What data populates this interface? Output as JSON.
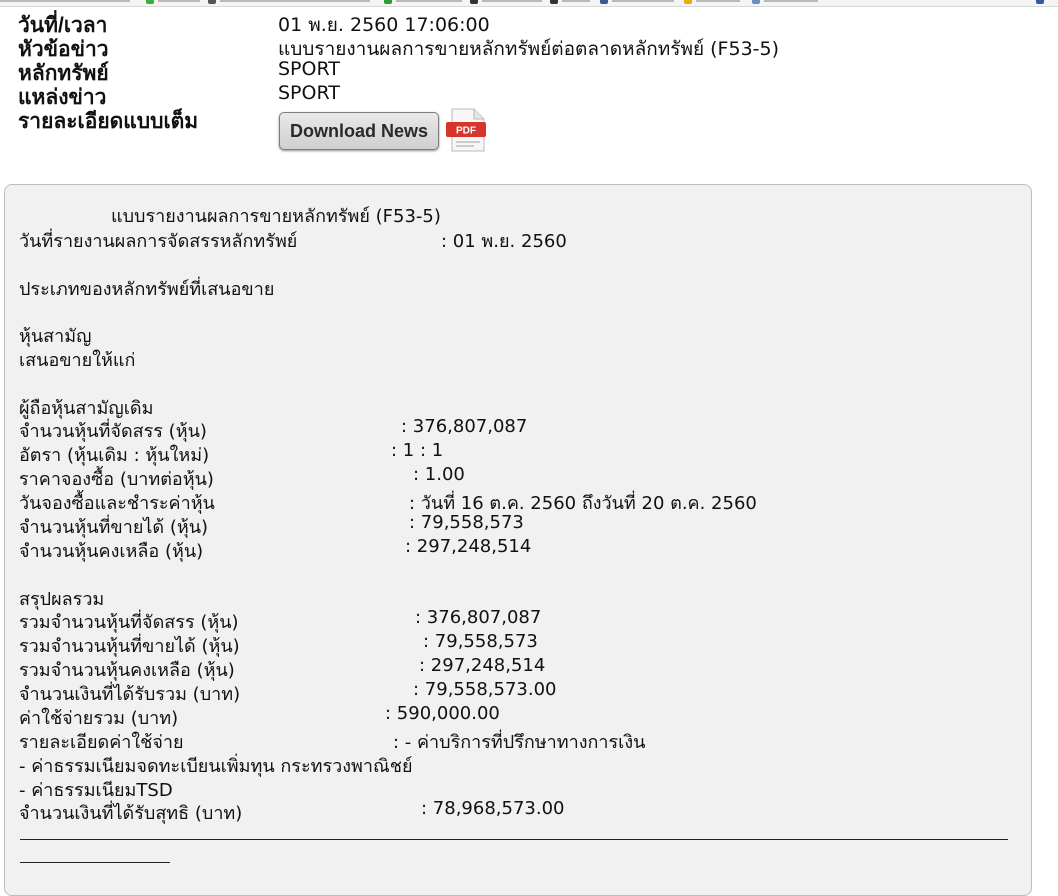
{
  "header": {
    "date_label": "วันที่/เวลา",
    "date_value": "01 พ.ย. 2560 17:06:00",
    "title_label": "หัวข้อข่าว",
    "title_value": "แบบรายงานผลการขายหลักทรัพย์ต่อตลาดหลักทรัพย์ (F53-5)",
    "symbol_label": "หลักทรัพย์",
    "symbol_value": "SPORT",
    "source_label": "แหล่งข่าว",
    "source_value": "SPORT",
    "detail_label": "รายละเอียดแบบเต็ม",
    "download_label": "Download News",
    "pdf_label": "PDF"
  },
  "news": {
    "form_title": "แบบรายงานผลการขายหลักทรัพย์ (F53-5)",
    "report_date_label": "วันที่รายงานผลการจัดสรรหลักทรัพย์",
    "report_date_value": ": 01 พ.ย. 2560",
    "security_type_label": "ประเภทของหลักทรัพย์ที่เสนอขาย",
    "security_type_value": "หุ้นสามัญ",
    "offered_to_label": "เสนอขายให้แก่",
    "offered_to_value": "ผู้ถือหุ้นสามัญเดิม",
    "allocated_label": "จำนวนหุ้นที่จัดสรร (หุ้น)",
    "allocated_value": ": 376,807,087",
    "ratio_label": "อัตรา (หุ้นเดิม : หุ้นใหม่)",
    "ratio_value": ": 1 : 1",
    "price_label": "ราคาจองซื้อ (บาทต่อหุ้น)",
    "price_value": ": 1.00",
    "period_label": "วันจองซื้อและชำระค่าหุ้น",
    "period_value": ": วันที่ 16 ต.ค. 2560 ถึงวันที่ 20 ต.ค. 2560",
    "sold_label": "จำนวนหุ้นที่ขายได้ (หุ้น)",
    "sold_value": ": 79,558,573",
    "remaining_label": "จำนวนหุ้นคงเหลือ (หุ้น)",
    "remaining_value": ": 297,248,514",
    "summary_label": "สรุปผลรวม",
    "total_allocated_label": "รวมจำนวนหุ้นที่จัดสรร  (หุ้น)",
    "total_allocated_value": ": 376,807,087",
    "total_sold_label": "รวมจำนวนหุ้นที่ขายได้ (หุ้น)",
    "total_sold_value": ": 79,558,573",
    "total_remaining_label": "รวมจำนวนหุ้นคงเหลือ (หุ้น)",
    "total_remaining_value": ": 297,248,514",
    "gross_label": "จำนวนเงินที่ได้รับรวม (บาท)",
    "gross_value": ": 79,558,573.00",
    "expenses_label": "ค่าใช้จ่ายรวม (บาท)",
    "expenses_value": ": 590,000.00",
    "expense_detail_label": "รายละเอียดค่าใช้จ่าย",
    "expense_detail_value": ": - ค่าบริการที่ปรึกษาทางการเงิน",
    "expense_item_2": "- ค่าธรรมเนียมจดทะเบียนเพิ่มทุน กระทรวงพาณิชย์",
    "expense_item_3": "- ค่าธรรมเนียมTSD",
    "net_label": "จำนวนเงินที่ได้รับสุทธิ (บาท)",
    "net_value": ": 78,968,573.00"
  },
  "colors": {
    "pdf_red": "#d9342b",
    "box_bg": "#f1f1f1"
  }
}
